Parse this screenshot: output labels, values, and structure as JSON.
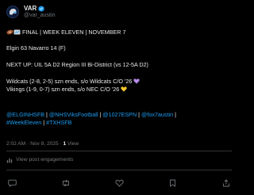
{
  "author": {
    "display_name": "VAR",
    "handle": "@var_austin",
    "avatar_icon": "helmet-logo-icon",
    "verified_color": "#1d9bf0"
  },
  "post": {
    "line1": "FINAL | WEEK ELEVEN | NOVEMBER 7",
    "line2": "Elgin 63 Navarro 14 (F)",
    "line3": "NEXT UP: UIL 5A D2 Region III Bi-District (vs 12-5A D2)",
    "line4": "Wildcats (2-8, 2-5) szn ends, s/o Wildcats C/O '26",
    "line5": "Vikings (1-9, 0-7) szn ends, s/o NEC C/O '26",
    "mentions": [
      "@ELGINHSFB",
      "@NHSViksFootball",
      "@1027ESPN",
      "@fox7austin"
    ],
    "hashtags": [
      "#WeekEleven",
      "#TXHSFB"
    ],
    "separator": " | "
  },
  "meta": {
    "time": "2:02 AM",
    "date": "Nov 8, 2025",
    "dot": " · ",
    "views_count": "1",
    "views_label": " View"
  },
  "engagement": {
    "label": "View post engagements"
  },
  "colors": {
    "background": "#000000",
    "text": "#e7e9ea",
    "muted": "#71767b",
    "link": "#1d9bf0",
    "divider": "#2f3336"
  },
  "action_icons": [
    "reply-icon",
    "retweet-icon",
    "like-icon",
    "bookmark-icon",
    "share-icon"
  ]
}
